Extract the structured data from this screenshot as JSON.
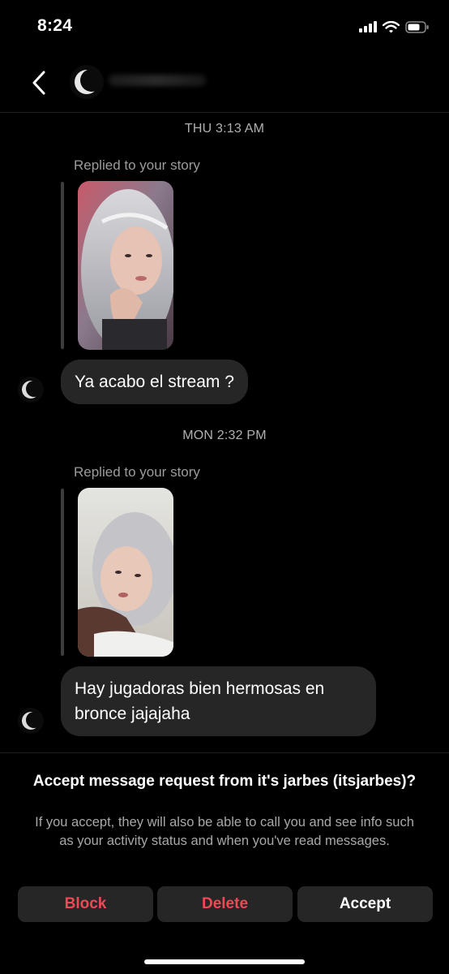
{
  "status_bar": {
    "time": "8:24"
  },
  "thread": {
    "groups": [
      {
        "timestamp": "THU 3:13 AM",
        "replied_label": "Replied to your story",
        "message": "Ya acabo el stream ?"
      },
      {
        "timestamp": "MON 2:32 PM",
        "replied_label": "Replied to your story",
        "message": "Hay jugadoras bien hermosas en bronce jajajaha"
      }
    ]
  },
  "request": {
    "title": "Accept message request from it's jarbes (itsjarbes)?",
    "body": "If you accept, they will also be able to call you and see info such as your activity status and when you've read messages."
  },
  "actions": {
    "block": "Block",
    "delete": "Delete",
    "accept": "Accept"
  },
  "colors": {
    "background": "#000000",
    "bubble": "#262626",
    "danger": "#ed4956"
  },
  "icons": [
    "back-chevron-icon",
    "signal-icon",
    "wifi-icon",
    "battery-icon"
  ]
}
